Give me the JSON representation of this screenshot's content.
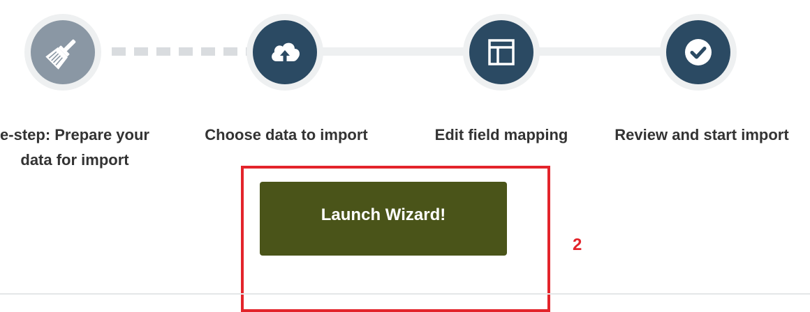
{
  "wizard": {
    "steps": [
      {
        "line1": "e-step: Prepare your",
        "line2": "data for import",
        "icon": "broom-icon",
        "state": "done"
      },
      {
        "line1": "Choose data to import",
        "line2": "",
        "icon": "cloud-upload-icon",
        "state": "pending"
      },
      {
        "line1": "Edit field mapping",
        "line2": "",
        "icon": "layout-icon",
        "state": "pending"
      },
      {
        "line1": "Review and start import",
        "line2": "",
        "icon": "check-circle-icon",
        "state": "pending"
      }
    ],
    "launch_label": "Launch Wizard!"
  },
  "annotation": {
    "number": "2"
  },
  "colors": {
    "step_active": "#2b4a63",
    "step_done": "#8a97a4",
    "button": "#4a5419",
    "highlight": "#e3242b"
  }
}
